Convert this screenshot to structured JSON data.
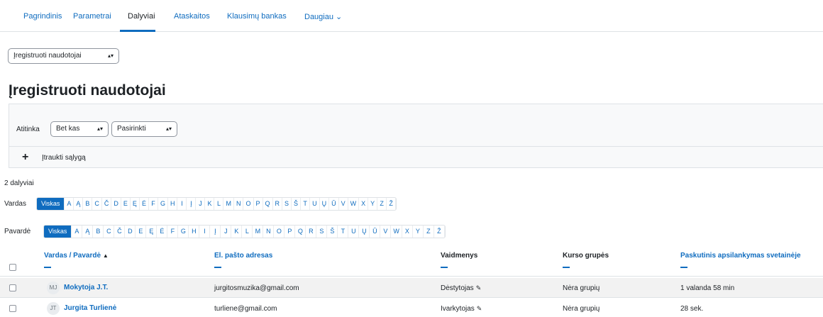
{
  "nav": {
    "tabs": [
      {
        "label": "Pagrindinis"
      },
      {
        "label": "Parametrai"
      },
      {
        "label": "Dalyviai"
      },
      {
        "label": "Ataskaitos"
      },
      {
        "label": "Klausimų bankas"
      },
      {
        "label": "Daugiau ⌄"
      }
    ],
    "active_index": 2
  },
  "page_select": {
    "value": "Įregistruoti naudotojai"
  },
  "title": "Įregistruoti naudotojai",
  "filter": {
    "match_label": "Atitinka",
    "match_value": "Bet kas",
    "select_value": "Pasirinkti",
    "add_condition": "Įtraukti sąlygą"
  },
  "participant_count": "2 dalyviai",
  "firstname_bar": {
    "label": "Vardas",
    "letters": [
      "Viskas",
      "A",
      "Ą",
      "B",
      "C",
      "Č",
      "D",
      "E",
      "Ę",
      "Ė",
      "F",
      "G",
      "H",
      "I",
      "Į",
      "J",
      "K",
      "L",
      "M",
      "N",
      "O",
      "P",
      "Q",
      "R",
      "S",
      "Š",
      "T",
      "U",
      "Ų",
      "Ū",
      "V",
      "W",
      "X",
      "Y",
      "Z",
      "Ž"
    ]
  },
  "lastname_bar": {
    "label": "Pavardė",
    "letters": [
      "Viskas",
      "A",
      "Ą",
      "B",
      "C",
      "Č",
      "D",
      "E",
      "Ę",
      "Ė",
      "F",
      "G",
      "H",
      "I",
      "Į",
      "J",
      "K",
      "L",
      "M",
      "N",
      "O",
      "P",
      "Q",
      "R",
      "S",
      "Š",
      "T",
      "U",
      "Ų",
      "Ū",
      "V",
      "W",
      "X",
      "Y",
      "Z",
      "Ž"
    ]
  },
  "table": {
    "headers": {
      "name": "Vardas / Pavardė",
      "sort_indicator": "▲",
      "email": "El. pašto adresas",
      "roles": "Vaidmenys",
      "groups": "Kurso grupės",
      "last_access": "Paskutinis apsilankymas svetainėje"
    },
    "rows": [
      {
        "initials": "MJ",
        "name": "Mokytoja J.T.",
        "email": "jurgitosmuzika@gmail.com",
        "role": "Dėstytojas",
        "groups": "Nėra grupių",
        "last_access": "1 valanda 58 min"
      },
      {
        "initials": "JT",
        "name": "Jurgita Turlienė",
        "email": "turliene@gmail.com",
        "role": "Ivarkytojas",
        "groups": "Nėra grupių",
        "last_access": "28 sek."
      }
    ]
  },
  "colors": {
    "accent": "#0f6cbf",
    "text": "#1d2125",
    "border": "#dee2e6"
  }
}
